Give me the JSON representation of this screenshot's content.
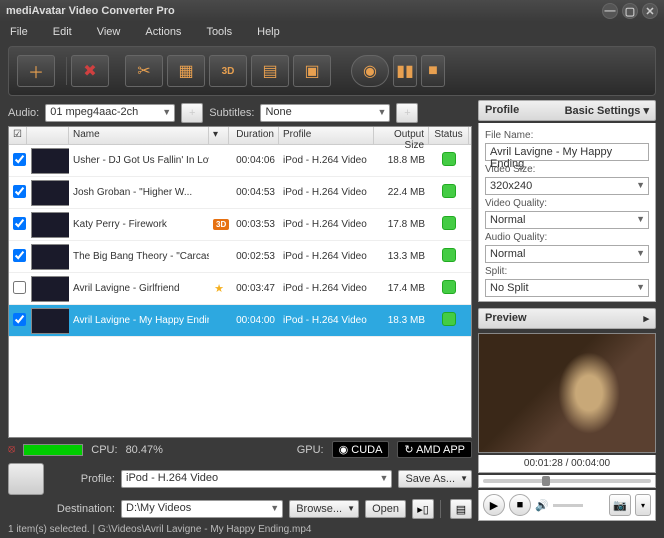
{
  "title": "mediAvatar Video Converter Pro",
  "menu": [
    "File",
    "Edit",
    "View",
    "Actions",
    "Tools",
    "Help"
  ],
  "audio": {
    "label": "Audio:",
    "value": "01 mpeg4aac-2ch"
  },
  "subtitles": {
    "label": "Subtitles:",
    "value": "None"
  },
  "columns": {
    "chk": "",
    "name": "Name",
    "duration": "Duration",
    "profile": "Profile",
    "size": "Output Size",
    "status": "Status"
  },
  "rows": [
    {
      "checked": true,
      "name": "Usher - DJ Got Us Fallin' In Lov...",
      "duration": "00:04:06",
      "profile": "iPod - H.264 Video",
      "size": "18.8 MB",
      "badge": ""
    },
    {
      "checked": true,
      "name": "Josh Groban - &quot;Higher W...",
      "duration": "00:04:53",
      "profile": "iPod - H.264 Video",
      "size": "22.4 MB",
      "badge": ""
    },
    {
      "checked": true,
      "name": "Katy Perry - Firework",
      "duration": "00:03:53",
      "profile": "iPod - H.264 Video",
      "size": "17.8 MB",
      "badge": "3D"
    },
    {
      "checked": true,
      "name": "The Big Bang Theory - \"Carcas...",
      "duration": "00:02:53",
      "profile": "iPod - H.264 Video",
      "size": "13.3 MB",
      "badge": ""
    },
    {
      "checked": false,
      "name": "Avril Lavigne - Girlfriend",
      "duration": "00:03:47",
      "profile": "iPod - H.264 Video",
      "size": "17.4 MB",
      "badge": "star"
    },
    {
      "checked": true,
      "name": "Avril Lavigne - My Happy Ending",
      "duration": "00:04:00",
      "profile": "iPod - H.264 Video",
      "size": "18.3 MB",
      "badge": "",
      "selected": true
    }
  ],
  "cpu": {
    "label": "CPU:",
    "value": "80.47%"
  },
  "gpu": {
    "label": "GPU:",
    "cuda": "CUDA",
    "amd": "AMD APP"
  },
  "dest": {
    "profileLabel": "Profile:",
    "profileValue": "iPod - H.264 Video",
    "saveAs": "Save As...",
    "destLabel": "Destination:",
    "destValue": "D:\\My Videos",
    "browse": "Browse...",
    "open": "Open"
  },
  "status": "1 item(s) selected. | G:\\Videos\\Avril Lavigne - My Happy Ending.mp4",
  "sidebar": {
    "profileHdr": "Profile",
    "basicSettings": "Basic Settings",
    "fileName": {
      "label": "File Name:",
      "value": "Avril Lavigne - My Happy Ending"
    },
    "videoSize": {
      "label": "Video Size:",
      "value": "320x240"
    },
    "videoQuality": {
      "label": "Video Quality:",
      "value": "Normal"
    },
    "audioQuality": {
      "label": "Audio Quality:",
      "value": "Normal"
    },
    "split": {
      "label": "Split:",
      "value": "No Split"
    },
    "previewHdr": "Preview",
    "time": "00:01:28 / 00:04:00"
  }
}
